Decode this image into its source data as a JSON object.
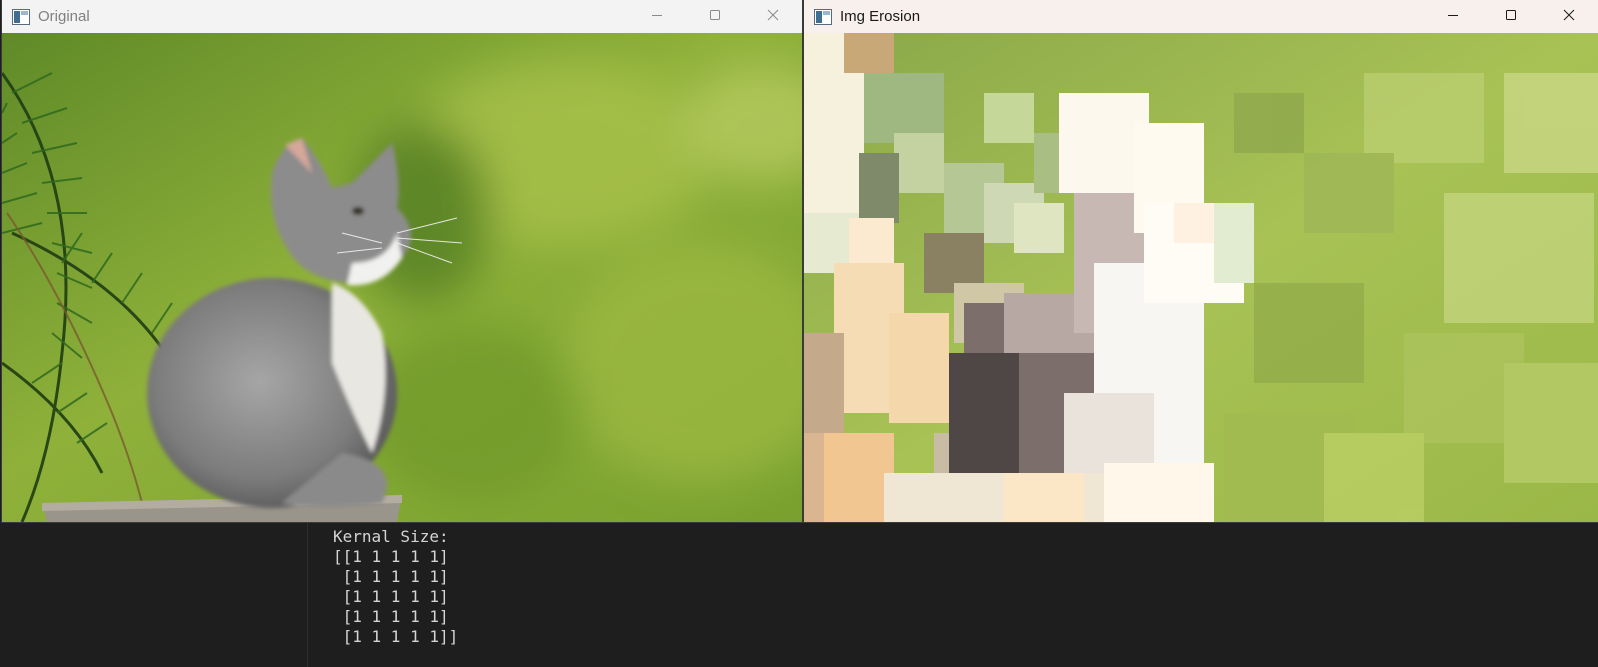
{
  "windows": {
    "original": {
      "title": "Original",
      "icon": "opencv-window-icon",
      "controls": [
        "minimize-icon",
        "maximize-icon",
        "close-icon"
      ]
    },
    "erosion": {
      "title": "Img Erosion",
      "icon": "opencv-window-icon",
      "controls": [
        "minimize-icon",
        "maximize-icon",
        "close-icon"
      ]
    }
  },
  "terminal": {
    "lines": [
      "Kernal Size:",
      "[[1 1 1 1 1]",
      " [1 1 1 1 1]",
      " [1 1 1 1 1]",
      " [1 1 1 1 1]",
      " [1 1 1 1 1]]"
    ]
  },
  "colors": {
    "terminal_bg": "#1e1e1e",
    "terminal_text": "#d4d4d4",
    "background_green": "#8fb13a"
  }
}
